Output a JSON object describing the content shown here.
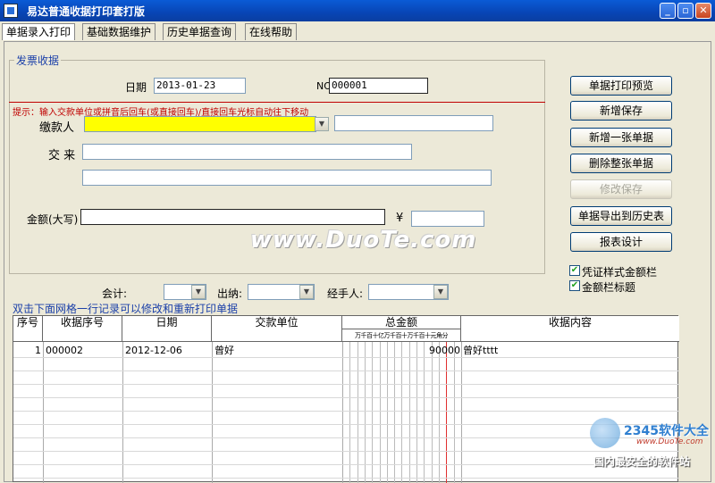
{
  "window": {
    "title": "易达普通收据打印套打版"
  },
  "tabs": [
    {
      "label": "单据录入打印"
    },
    {
      "label": "基础数据维护"
    },
    {
      "label": "历史单据查询"
    },
    {
      "label": "在线帮助"
    }
  ],
  "form": {
    "group_title": "发票收据",
    "date_label": "日期",
    "date_value": "2013-01-23",
    "no_label": "NO",
    "no_value": "000001",
    "hint": "提示：输入交款单位或拼音后回车(或直接回车)/直接回车光标自动往下移动",
    "payer_label": "缴款人",
    "payer_value": "",
    "payer_extra_value": "",
    "reason_label": "交 来",
    "reason_value": "",
    "reason_extra_value": "",
    "amount_label": "金额(大写)",
    "amount_value": "",
    "yen_symbol": "¥",
    "yen_value": ""
  },
  "buttons": {
    "print_preview": "单据打印预览",
    "new_save": "新增保存",
    "new_receipt": "新增一张单据",
    "delete_receipt": "删除整张单据",
    "modify_save": "修改保存",
    "export_history": "单据导出到历史表",
    "report_design": "报表设计"
  },
  "checkboxes": {
    "voucher_amount": {
      "label": "凭证样式金额栏",
      "checked": true
    },
    "amount_title": {
      "label": "金额栏标题",
      "checked": true
    }
  },
  "signers": {
    "accountant_label": "会计:",
    "accountant_value": "",
    "cashier_label": "出纳:",
    "cashier_value": "",
    "handler_label": "经手人:",
    "handler_value": ""
  },
  "grid": {
    "caption": "双击下面网格一行记录可以修改和重新打印单据",
    "columns": [
      "序号",
      "收据序号",
      "日期",
      "交款单位",
      "总金额",
      "收据内容"
    ],
    "amount_units": "万千百十亿万千百十万千百十元角分",
    "rows": [
      {
        "index": "1",
        "receipt_no": "000002",
        "date": "2012-12-06",
        "payer": "曾好",
        "amount": "90000",
        "content": "曾好tttt"
      }
    ]
  },
  "watermark": {
    "text": "www.DuoTe.com"
  },
  "branding": {
    "logo_text": "2345软件大全",
    "logo_url": "www.DuoTe.com",
    "footer": "国内最安全的软件站"
  },
  "colors": {
    "title_bar": "#0a4fc8",
    "payer_highlight": "#ffff00",
    "hint_red": "#c00000",
    "group_title": "#1a3fa8"
  }
}
